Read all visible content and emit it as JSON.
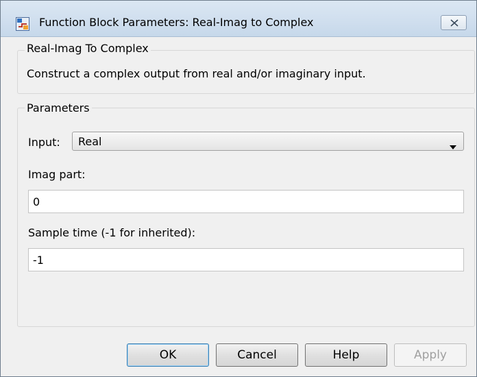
{
  "window": {
    "title": "Function Block Parameters: Real-Imag to Complex",
    "app_icon": "simulink-block-icon",
    "close_icon": "close-icon"
  },
  "block": {
    "group_label": "Real-Imag To Complex",
    "description": "Construct a complex output from real and/or imaginary input."
  },
  "parameters": {
    "group_label": "Parameters",
    "input": {
      "label": "Input:",
      "selected": "Real"
    },
    "imag_part": {
      "label": "Imag part:",
      "value": "0"
    },
    "sample_time": {
      "label": "Sample time (-1 for inherited):",
      "value": "-1"
    }
  },
  "buttons": {
    "ok": "OK",
    "cancel": "Cancel",
    "help": "Help",
    "apply": "Apply"
  }
}
